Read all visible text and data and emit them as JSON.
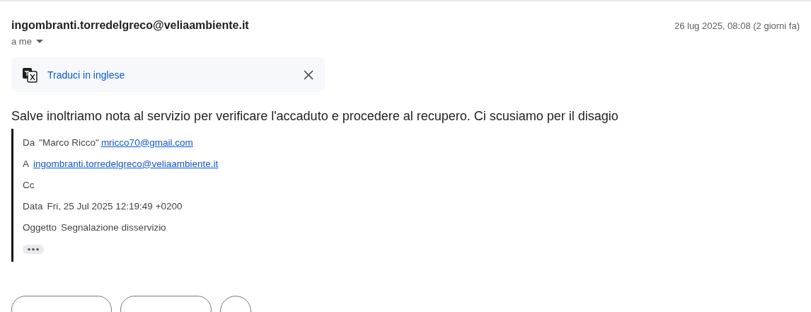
{
  "message": {
    "sender": "ingombranti.torredelgreco@veliaambiente.it",
    "date": "26 lug 2025, 08:08 (2 giorni fa)",
    "recipient_label": "a me"
  },
  "translate_bar": {
    "label": "Traduci in inglese"
  },
  "body": "Salve inoltriamo nota al servizio per verificare l'accaduto e procedere al recupero. Ci scusiamo per il disagio",
  "quoted_header": {
    "fields": [
      {
        "label": "Da",
        "value": "\"Marco Ricco\"",
        "link": "mricco70@gmail.com"
      },
      {
        "label": "A",
        "link": "ingombranti.torredelgreco@veliaambiente.it"
      },
      {
        "label": "Cc"
      },
      {
        "label": "Data",
        "value": "Fri, 25 Jul 2025 12:19:49 +0200"
      },
      {
        "label": "Oggetto",
        "value": "Segnalazione disservizio"
      }
    ]
  },
  "actions": [
    {
      "kind": "pill"
    },
    {
      "kind": "pill"
    },
    {
      "kind": "circle"
    }
  ]
}
